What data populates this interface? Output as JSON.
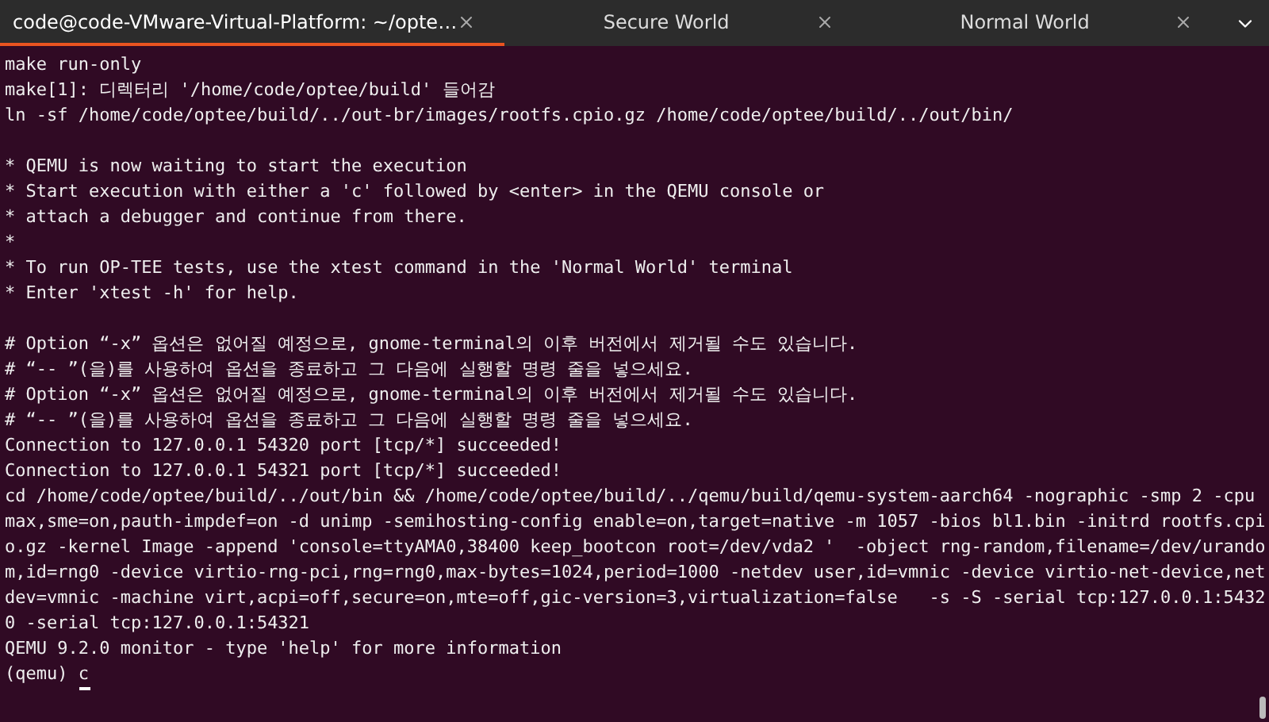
{
  "tabs": [
    {
      "label": "code@code-VMware-Virtual-Platform: ~/opte…",
      "selected": true
    },
    {
      "label": "Secure World",
      "selected": false
    },
    {
      "label": "Normal World",
      "selected": false
    }
  ],
  "terminal": {
    "blocks": [
      [
        "make run-only",
        "make[1]: 디렉터리 '/home/code/optee/build' 들어감",
        "ln -sf /home/code/optee/build/../out-br/images/rootfs.cpio.gz /home/code/optee/build/../out/bin/"
      ],
      [
        "* QEMU is now waiting to start the execution",
        "* Start execution with either a 'c' followed by <enter> in the QEMU console or",
        "* attach a debugger and continue from there.",
        "*",
        "* To run OP-TEE tests, use the xtest command in the 'Normal World' terminal",
        "* Enter 'xtest -h' for help."
      ],
      [
        "# Option “-x” 옵션은 없어질 예정으로, gnome-terminal의 이후 버전에서 제거될 수도 있습니다.",
        "# “-- ”(을)를 사용하여 옵션을 종료하고 그 다음에 실행할 명령 줄을 넣으세요.",
        "# Option “-x” 옵션은 없어질 예정으로, gnome-terminal의 이후 버전에서 제거될 수도 있습니다.",
        "# “-- ”(을)를 사용하여 옵션을 종료하고 그 다음에 실행할 명령 줄을 넣으세요.",
        "Connection to 127.0.0.1 54320 port [tcp/*] succeeded!",
        "Connection to 127.0.0.1 54321 port [tcp/*] succeeded!",
        "cd /home/code/optee/build/../out/bin && /home/code/optee/build/../qemu/build/qemu-system-aarch64 -nographic -smp 2 -cpu",
        "max,sme=on,pauth-impdef=on -d unimp -semihosting-config enable=on,target=native -m 1057 -bios bl1.bin -initrd rootfs.cpi",
        "o.gz -kernel Image -append 'console=ttyAMA0,38400 keep_bootcon root=/dev/vda2 '  -object rng-random,filename=/dev/urando",
        "m,id=rng0 -device virtio-rng-pci,rng=rng0,max-bytes=1024,period=1000 -netdev user,id=vmnic -device virtio-net-device,net",
        "dev=vmnic -machine virt,acpi=off,secure=on,mte=off,gic-version=3,virtualization=false   -s -S -serial tcp:127.0.0.1:5432",
        "0 -serial tcp:127.0.0.1:54321",
        "QEMU 9.2.0 monitor - type 'help' for more information"
      ]
    ],
    "prompt_line": "(qemu) c"
  }
}
